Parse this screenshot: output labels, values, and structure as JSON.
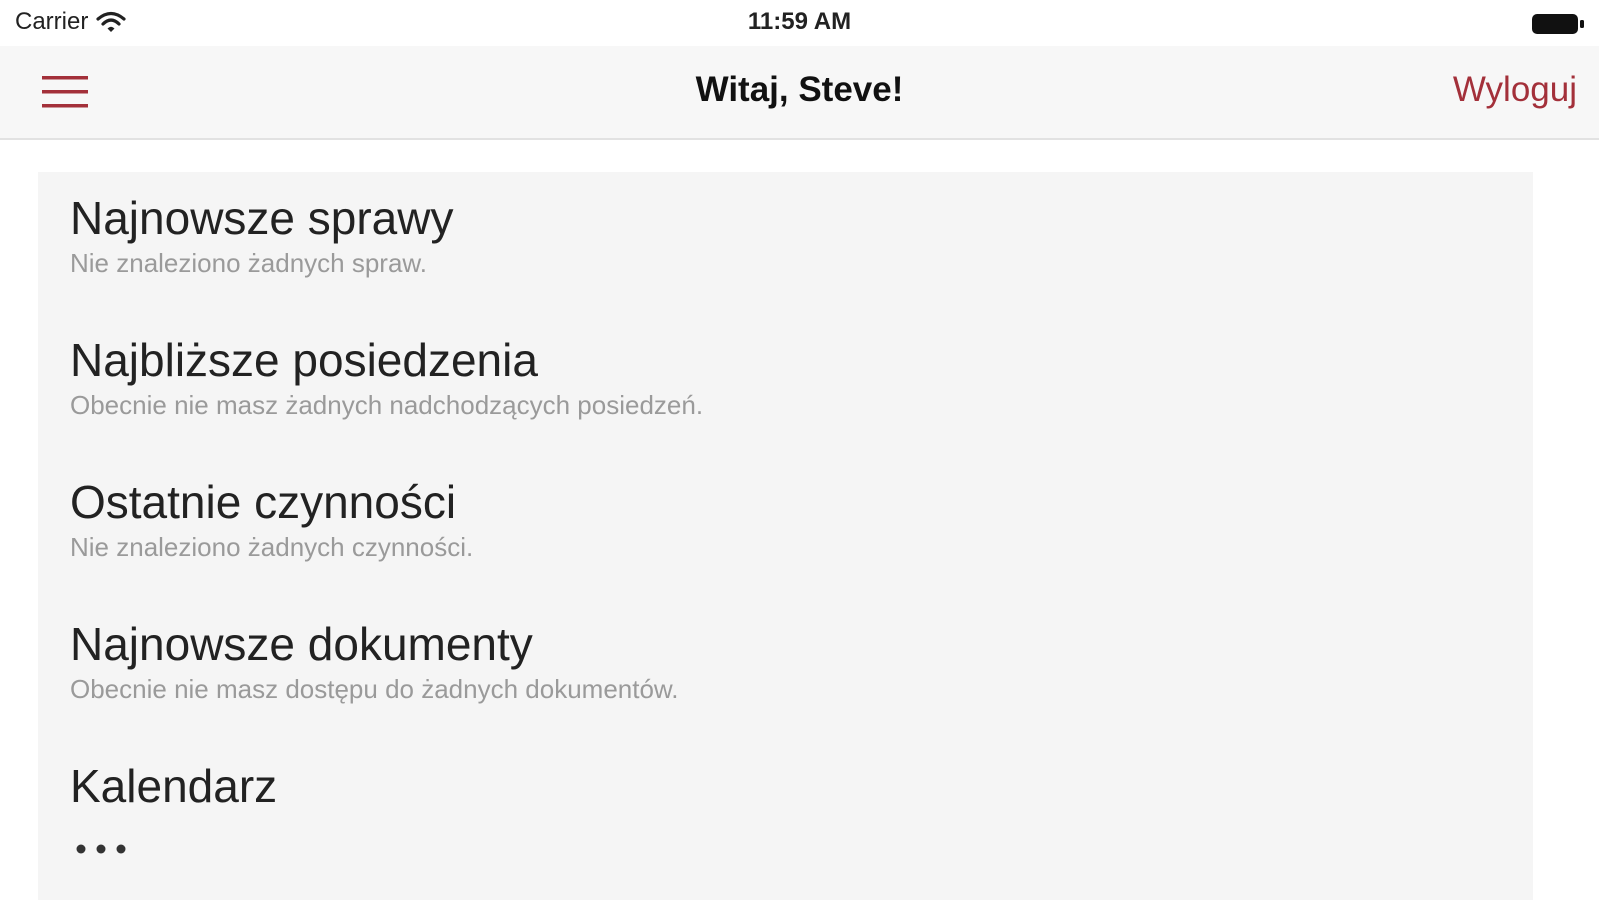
{
  "status_bar": {
    "carrier": "Carrier",
    "time": "11:59 AM",
    "icons": [
      "wifi-icon",
      "battery-icon"
    ]
  },
  "nav": {
    "menu_icon": "hamburger-menu-icon",
    "title": "Witaj, Steve!",
    "logout_label": "Wyloguj"
  },
  "colors": {
    "accent": "#a3303a",
    "nav_background": "#f7f7f7",
    "content_background": "#f5f5f5",
    "subtitle_text": "#9a9a9a"
  },
  "sections": [
    {
      "title": "Najnowsze sprawy",
      "subtitle": "Nie znaleziono żadnych spraw."
    },
    {
      "title": "Najbliższe posiedzenia",
      "subtitle": "Obecnie nie masz żadnych nadchodzących posiedzeń."
    },
    {
      "title": "Ostatnie czynności",
      "subtitle": "Nie znaleziono żadnych czynności."
    },
    {
      "title": "Najnowsze dokumenty",
      "subtitle": "Obecnie nie masz dostępu do żadnych dokumentów."
    },
    {
      "title": "Kalendarz",
      "loading_icon": "loading-dots-icon"
    }
  ]
}
